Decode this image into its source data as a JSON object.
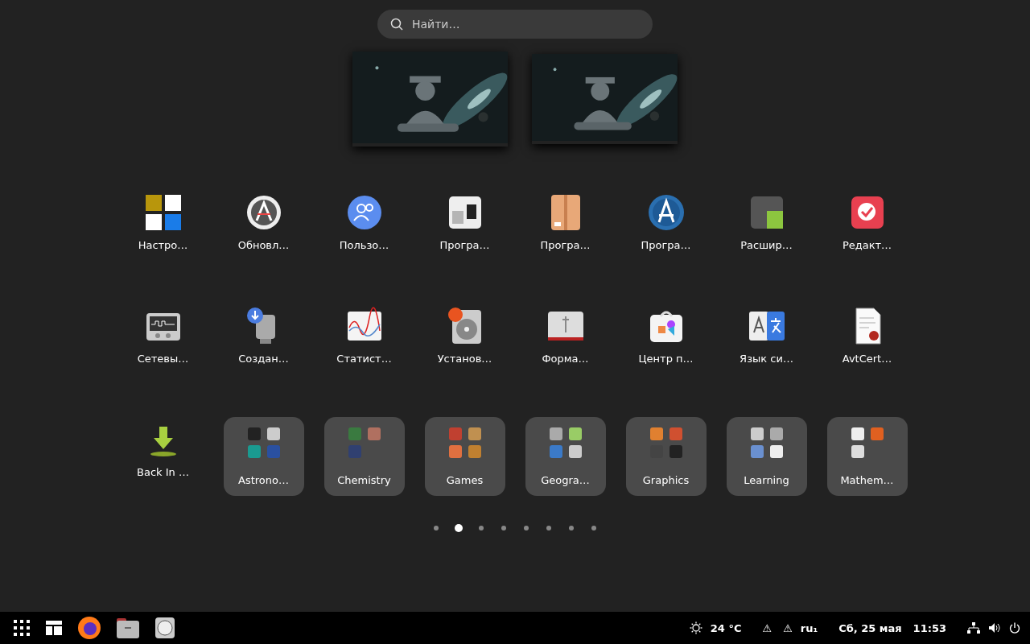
{
  "search": {
    "placeholder": "Найти…"
  },
  "apps": [
    {
      "kind": "app",
      "label": "Настро…"
    },
    {
      "kind": "app",
      "label": "Обновл…"
    },
    {
      "kind": "app",
      "label": "Пользо…"
    },
    {
      "kind": "app",
      "label": "Програ…"
    },
    {
      "kind": "app",
      "label": "Програ…"
    },
    {
      "kind": "app",
      "label": "Програ…"
    },
    {
      "kind": "app",
      "label": "Расшир…"
    },
    {
      "kind": "app",
      "label": "Редакт…"
    },
    {
      "kind": "app",
      "label": "Сетевы…"
    },
    {
      "kind": "app",
      "label": "Создан…"
    },
    {
      "kind": "app",
      "label": "Статист…"
    },
    {
      "kind": "app",
      "label": "Установ…"
    },
    {
      "kind": "app",
      "label": "Форма…"
    },
    {
      "kind": "app",
      "label": "Центр п…"
    },
    {
      "kind": "app",
      "label": "Язык си…"
    },
    {
      "kind": "app",
      "label": "AvtCert…"
    },
    {
      "kind": "app",
      "label": "Back In …"
    },
    {
      "kind": "folder",
      "label": "Astrono…"
    },
    {
      "kind": "folder",
      "label": "Chemistry"
    },
    {
      "kind": "folder",
      "label": "Games"
    },
    {
      "kind": "folder",
      "label": "Geogra…"
    },
    {
      "kind": "folder",
      "label": "Graphics"
    },
    {
      "kind": "folder",
      "label": "Learning"
    },
    {
      "kind": "folder",
      "label": "Mathem…"
    }
  ],
  "pages": [
    {
      "selected": false
    },
    {
      "selected": true
    },
    {
      "selected": false
    },
    {
      "selected": false
    },
    {
      "selected": false
    },
    {
      "selected": false
    },
    {
      "selected": false
    },
    {
      "selected": false
    }
  ],
  "taskbar": {
    "weather": "24 °C",
    "alerts": [
      "⚠",
      "⚠"
    ],
    "keyboard_layout": "ru₁",
    "date": "Сб, 25 мая",
    "time": "11:53"
  }
}
